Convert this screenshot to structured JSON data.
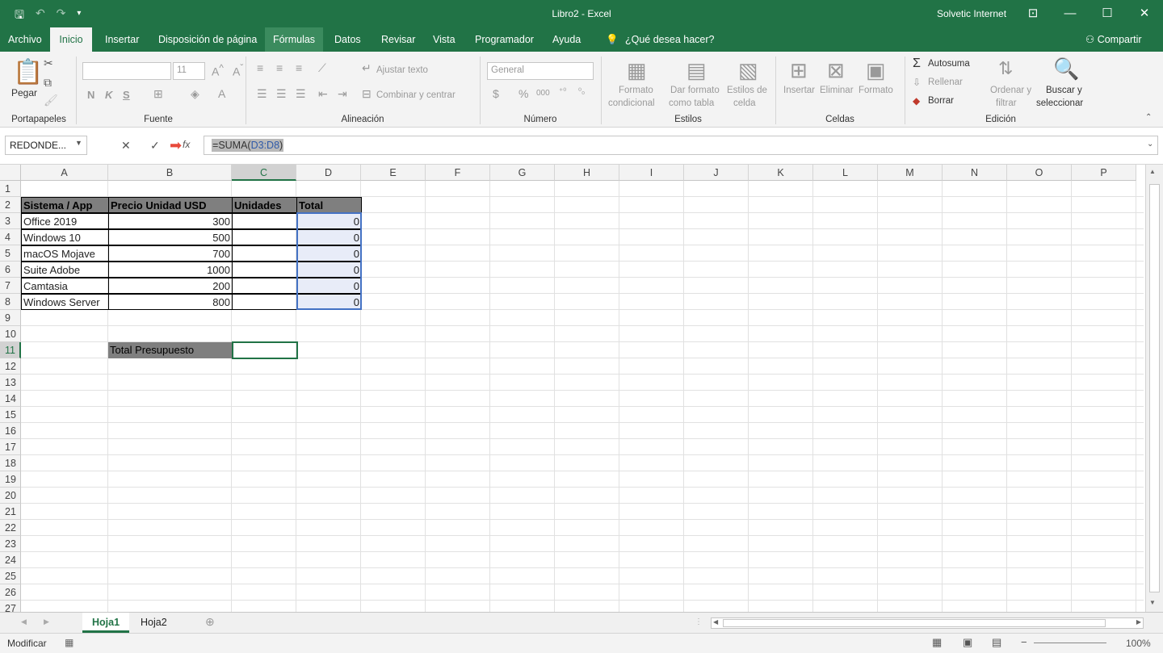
{
  "titlebar": {
    "title": "Libro2 - Excel",
    "user": "Solvetic Internet",
    "save_icon": "save-icon",
    "undo_icon": "undo-icon",
    "redo_icon": "redo-icon"
  },
  "menu": {
    "tabs": [
      "Archivo",
      "Inicio",
      "Insertar",
      "Disposición de página",
      "Fórmulas",
      "Datos",
      "Revisar",
      "Vista",
      "Programador",
      "Ayuda"
    ],
    "tell_me": "¿Qué desea hacer?",
    "share": "Compartir"
  },
  "ribbon": {
    "clipboard": {
      "paste": "Pegar",
      "label": "Portapapeles"
    },
    "font": {
      "size": "11",
      "label": "Fuente",
      "bold": "N",
      "italic": "K",
      "underline": "S"
    },
    "alignment": {
      "wrap": "Ajustar texto",
      "merge": "Combinar y centrar",
      "label": "Alineación"
    },
    "number": {
      "format": "General",
      "label": "Número"
    },
    "styles": {
      "cond_line1": "Formato",
      "cond_line2": "condicional",
      "table_line1": "Dar formato",
      "table_line2": "como tabla",
      "cell_line1": "Estilos de",
      "cell_line2": "celda",
      "label": "Estilos"
    },
    "cells": {
      "insert": "Insertar",
      "delete": "Eliminar",
      "format": "Formato",
      "label": "Celdas"
    },
    "editing": {
      "autosum": "Autosuma",
      "fill": "Rellenar",
      "clear": "Borrar",
      "sort_line1": "Ordenar y",
      "sort_line2": "filtrar",
      "find_line1": "Buscar y",
      "find_line2": "seleccionar",
      "label": "Edición"
    }
  },
  "formula_bar": {
    "name_box": "REDONDE...",
    "formula_eq": "=",
    "formula_fn": "SUMA(",
    "formula_ref": "D3:D8",
    "formula_close": ")"
  },
  "columns": [
    "A",
    "B",
    "C",
    "D",
    "E",
    "F",
    "G",
    "H",
    "I",
    "J",
    "K",
    "L",
    "M",
    "N",
    "O",
    "P"
  ],
  "rows": [
    "1",
    "2",
    "3",
    "4",
    "5",
    "6",
    "7",
    "8",
    "9",
    "10",
    "11",
    "12",
    "13",
    "14",
    "15",
    "16",
    "17",
    "18",
    "19",
    "20",
    "21",
    "22",
    "23",
    "24",
    "25",
    "26",
    "27"
  ],
  "table": {
    "headers": [
      "Sistema / App",
      "Precio Unidad USD",
      "Unidades",
      "Total"
    ],
    "rows": [
      {
        "app": "Office 2019",
        "price": "300",
        "total": "0"
      },
      {
        "app": "Windows 10",
        "price": "500",
        "total": "0"
      },
      {
        "app": "macOS Mojave",
        "price": "700",
        "total": "0"
      },
      {
        "app": "Suite Adobe",
        "price": "1000",
        "total": "0"
      },
      {
        "app": "Camtasia",
        "price": "200",
        "total": "0"
      },
      {
        "app": "Windows Server",
        "price": "800",
        "total": "0"
      }
    ],
    "total_label": "Total Presupuesto"
  },
  "sheets": [
    "Hoja1",
    "Hoja2"
  ],
  "status": {
    "mode": "Modificar",
    "zoom": "100%"
  }
}
